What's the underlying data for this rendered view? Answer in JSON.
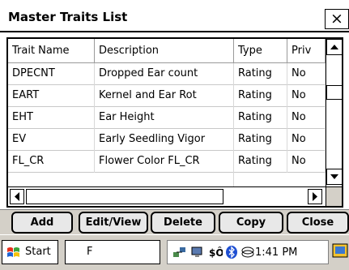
{
  "window": {
    "title": "Master Traits List",
    "close_label": "×"
  },
  "grid": {
    "columns": [
      "Trait Name",
      "Description",
      "Type",
      "Priv"
    ],
    "rows": [
      [
        "DPECNT",
        "Dropped Ear count",
        "Rating",
        "No"
      ],
      [
        "EART",
        "Kernel and Ear Rot",
        "Rating",
        "No"
      ],
      [
        "EHT",
        "Ear Height",
        "Rating",
        "No"
      ],
      [
        "EV",
        "Early Seedling Vigor",
        "Rating",
        "No"
      ],
      [
        "FL_CR",
        "Flower Color FL_CR",
        "Rating",
        "No"
      ]
    ]
  },
  "buttons": {
    "add": "Add",
    "edit_view": "Edit/View",
    "delete": "Delete",
    "copy": "Copy",
    "close": "Close"
  },
  "taskbar": {
    "start_label": "Start",
    "task_label": "F",
    "time": "1:41 PM"
  },
  "colors": {
    "accent": "#000000",
    "bar": "#d4d0c8",
    "windows_flag": [
      "#e8301c",
      "#3ca53c",
      "#1e63d2",
      "#f5c30c"
    ]
  },
  "icons": [
    "close-icon",
    "scroll-up-icon",
    "scroll-down-icon",
    "scroll-left-icon",
    "scroll-right-icon",
    "windows-logo-icon",
    "network-icon",
    "connection-icon",
    "sync-icon",
    "bluetooth-icon",
    "wireless-icon",
    "desktop-icon"
  ]
}
